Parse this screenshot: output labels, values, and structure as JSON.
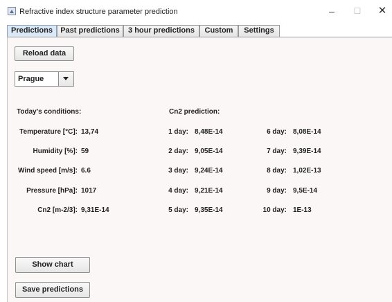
{
  "window": {
    "title": "Refractive index structure parameter prediction",
    "minimize": "–",
    "maximize": "☐",
    "close": "✕"
  },
  "tabs": [
    {
      "label": "Predictions",
      "active": true
    },
    {
      "label": "Past predictions",
      "active": false
    },
    {
      "label": "3 hour predictions",
      "active": false
    },
    {
      "label": "Custom",
      "active": false
    },
    {
      "label": "Settings",
      "active": false
    }
  ],
  "buttons": {
    "reload": "Reload data",
    "show_chart": "Show chart",
    "save_predictions": "Save predictions"
  },
  "location": {
    "selected": "Prague"
  },
  "conditions": {
    "heading": "Today's conditions:",
    "temperature": {
      "label": "Temperature [°C]:",
      "value": "13,74"
    },
    "humidity": {
      "label": "Humidity [%]:",
      "value": "59"
    },
    "wind": {
      "label": "Wind speed [m/s]:",
      "value": "6.6"
    },
    "pressure": {
      "label": "Pressure [hPa]:",
      "value": "1017"
    },
    "cn2": {
      "label": "Cn2 [m-2/3]:",
      "value": "9,31E-14"
    }
  },
  "prediction": {
    "heading": "Cn2 prediction:",
    "days": [
      {
        "label": "1 day:",
        "value": "8,48E-14"
      },
      {
        "label": "2 day:",
        "value": "9,05E-14"
      },
      {
        "label": "3 day:",
        "value": "9,24E-14"
      },
      {
        "label": "4 day:",
        "value": "9,21E-14"
      },
      {
        "label": "5 day:",
        "value": "9,35E-14"
      },
      {
        "label": "6 day:",
        "value": "8,08E-14"
      },
      {
        "label": "7 day:",
        "value": "9,39E-14"
      },
      {
        "label": "8 day:",
        "value": "1,02E-13"
      },
      {
        "label": "9 day:",
        "value": "9,5E-14"
      },
      {
        "label": "10 day:",
        "value": "1E-13"
      }
    ]
  },
  "colors": {
    "panel_background": "#fcf7f7",
    "active_tab": "#dbe8f6"
  }
}
